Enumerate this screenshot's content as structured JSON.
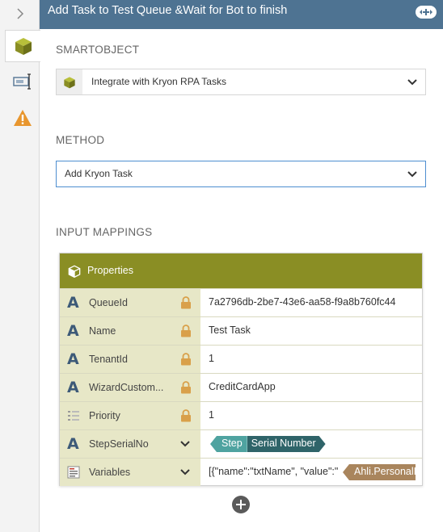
{
  "header": {
    "title": "Add Task to Test Queue &Wait for Bot to finish"
  },
  "smartobject": {
    "section_label": "SMARTOBJECT",
    "selected": "Integrate with Kryon RPA Tasks"
  },
  "method": {
    "section_label": "METHOD",
    "selected": "Add Kryon Task"
  },
  "input_mappings": {
    "section_label": "INPUT MAPPINGS",
    "panel_title": "Properties",
    "rows": [
      {
        "name": "QueueId",
        "type_glyph": "A",
        "value": "7a2796db-2be7-43e6-aa58-f9a8b760fc44"
      },
      {
        "name": "Name",
        "type_glyph": "A",
        "value": "Test Task"
      },
      {
        "name": "TenantId",
        "type_glyph": "A",
        "value": "1"
      },
      {
        "name": "WizardCustom...",
        "type_glyph": "A",
        "value": "CreditCardApp"
      },
      {
        "name": "Priority",
        "type_glyph": "list-numbered-icon",
        "value": "1"
      },
      {
        "name": "StepSerialNo",
        "type_glyph": "A",
        "tag_step": "Step",
        "tag_field": "Serial Number"
      },
      {
        "name": "Variables",
        "type_glyph": "document-lines-icon",
        "value": "[{\"name\":\"txtName\", \"value\":\"",
        "tag_field": "Ahli.PersonalIn"
      }
    ]
  },
  "colors": {
    "header": "#4e7392",
    "panel_header": "#8a8e24",
    "row_label_bg": "#e7e7c7",
    "lock": "#d9a04a",
    "step_tag": "#4fa3a0",
    "field_tag": "#2f6469",
    "variable_tag": "#a9855d"
  }
}
